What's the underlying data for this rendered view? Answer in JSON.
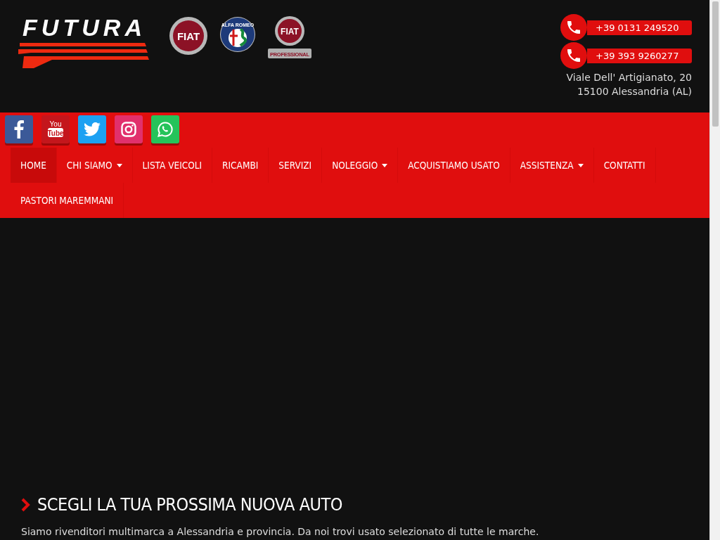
{
  "header": {
    "logo": "FUTURA",
    "brands": [
      {
        "kind": "fiat",
        "label": "FIAT"
      },
      {
        "kind": "alfa",
        "label": "ALFA ROMEO"
      },
      {
        "kind": "professional",
        "label": "FIAT",
        "sublabel": "PROFESSIONAL"
      }
    ],
    "phones": [
      "+39 0131 249520",
      "+39 393 9260277"
    ],
    "address": [
      "Viale Dell' Artigianato, 20",
      "15100 Alessandria (AL)"
    ]
  },
  "social": [
    {
      "kind": "facebook"
    },
    {
      "kind": "youtube",
      "label": "You",
      "sublabel": "Tube"
    },
    {
      "kind": "twitter"
    },
    {
      "kind": "instagram"
    },
    {
      "kind": "whatsapp"
    }
  ],
  "nav": [
    {
      "label": "HOME",
      "selected": true,
      "dropdown": false
    },
    {
      "label": "CHI SIAMO",
      "selected": false,
      "dropdown": true
    },
    {
      "label": "LISTA VEICOLI",
      "selected": false,
      "dropdown": false
    },
    {
      "label": "RICAMBI",
      "selected": false,
      "dropdown": false
    },
    {
      "label": "SERVIZI",
      "selected": false,
      "dropdown": false
    },
    {
      "label": "NOLEGGIO",
      "selected": false,
      "dropdown": true
    },
    {
      "label": "ACQUISTIAMO USATO",
      "selected": false,
      "dropdown": false
    },
    {
      "label": "ASSISTENZA",
      "selected": false,
      "dropdown": true
    },
    {
      "label": "CONTATTI",
      "selected": false,
      "dropdown": false
    },
    {
      "label": "PASTORI MAREMMANI",
      "selected": false,
      "dropdown": false
    }
  ],
  "section": {
    "title": "SCEGLI LA TUA PROSSIMA NUOVA AUTO",
    "text": "Siamo rivenditori multimarca a Alessandria e provincia. Da noi trovi usato selezionato di tutte le marche."
  }
}
